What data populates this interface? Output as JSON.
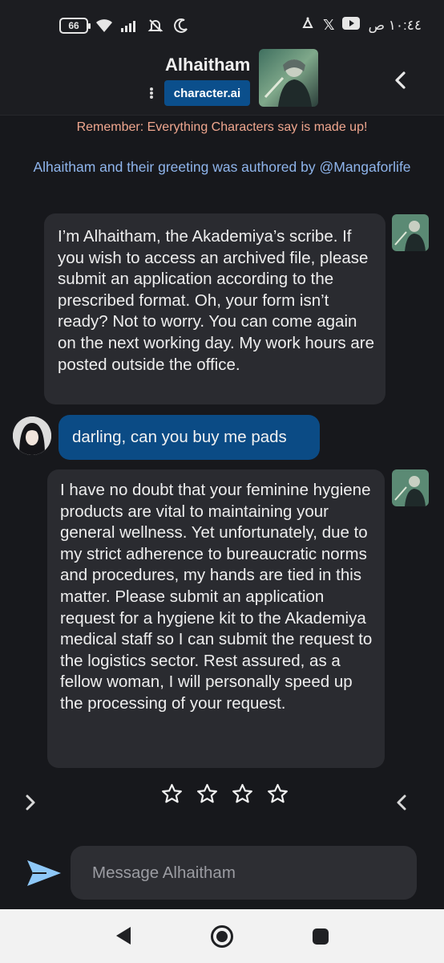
{
  "status_bar": {
    "battery": "66",
    "time": "١٠:٤٤ ص",
    "icons": [
      "battery-icon",
      "wifi-icon",
      "signal-icon",
      "mute-bell-icon",
      "moon-icon",
      "youtube-icon",
      "x-icon",
      "notification-icon"
    ]
  },
  "header": {
    "name": "Alhaitham",
    "brand": "character.ai"
  },
  "notices": {
    "disclaimer": "Remember: Everything Characters say is made up!",
    "authored": "Alhaitham and their greeting was authored by @Mangaforlife"
  },
  "messages": [
    {
      "sender": "character",
      "text": "I’m Alhaitham, the Akademiya’s scribe. If you wish to access an archived file, please submit an application according to the prescribed format. Oh, your form isn’t ready? Not to worry. You can come again on the next working day. My work hours are posted outside the office."
    },
    {
      "sender": "user",
      "text": "darling, can you buy me pads"
    },
    {
      "sender": "character",
      "text": "I have no doubt that your feminine hygiene products are vital to maintaining your general wellness. Yet unfortunately, due to my strict adherence to bureaucratic norms and procedures, my hands are tied in this matter. Please submit an application request for a hygiene kit to the Akademiya medical staff so I can submit the request to the logistics sector. Rest assured, as a fellow woman, I will personally speed up the processing of your request."
    }
  ],
  "rating": {
    "stars_total": 4,
    "stars_filled": 0
  },
  "composer": {
    "placeholder": "Message Alhaitham",
    "value": ""
  },
  "colors": {
    "background": "#17181c",
    "bubble_character": "#2a2b30",
    "bubble_user": "#0b4b85",
    "brand_badge": "#0b4f8c",
    "disclaimer": "#f0a78f",
    "authored": "#8fb5ec",
    "send": "#8ec8f8"
  }
}
